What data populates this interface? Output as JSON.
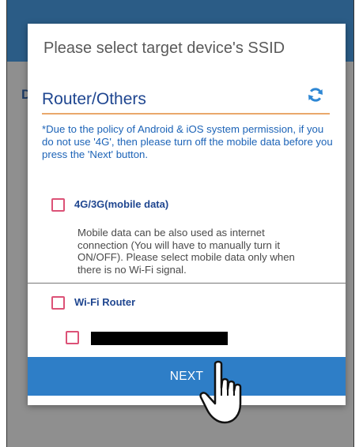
{
  "dialog": {
    "title": "Please select target device's SSID",
    "section_title": "Router/Others",
    "policy_note": "*Due to the policy of Android & iOS system permission, if you do not use '4G', then please turn off the mobile data before you press the 'Next' button.",
    "options": [
      {
        "label": "4G/3G(mobile data)",
        "checked": false
      },
      {
        "label": "Wi-Fi Router",
        "checked": false
      }
    ],
    "mobile_data_description": "Mobile data can be also used as internet connection (You will have to manually turn it ON/OFF). Please select mobile data only when there is no Wi-Fi signal.",
    "network_entry": {
      "checked": false
    },
    "next_label": "NEXT"
  },
  "background": {
    "partial_text": "D"
  },
  "colors": {
    "accent_blue": "#2e7ec7",
    "header_blue": "#2b5c86",
    "checkbox_pink": "#dc5277",
    "orange_rule": "#e9a86b"
  },
  "icons": [
    "refresh-icon",
    "pointing-hand-icon"
  ]
}
